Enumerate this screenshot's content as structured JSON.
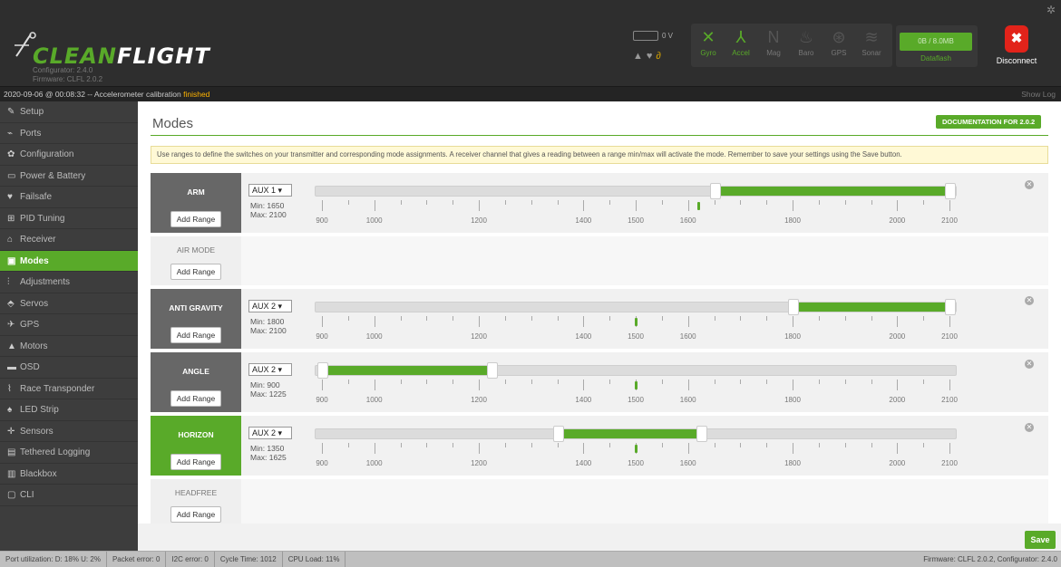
{
  "header": {
    "brand": "CLEANFLIGHT",
    "configurator": "Configurator: 2.4.0",
    "firmware": "Firmware: CLFL 2.0.2",
    "battery_voltage": "0 V",
    "sensors": [
      {
        "label": "Gyro",
        "icon": "gyro-icon",
        "active": true
      },
      {
        "label": "Accel",
        "icon": "accel-icon",
        "active": true
      },
      {
        "label": "Mag",
        "icon": "mag-icon",
        "active": false
      },
      {
        "label": "Baro",
        "icon": "baro-icon",
        "active": false
      },
      {
        "label": "GPS",
        "icon": "gps-icon",
        "active": false
      },
      {
        "label": "Sonar",
        "icon": "sonar-icon",
        "active": false
      }
    ],
    "dataflash_usage": "0B / 8.0MB",
    "dataflash_label": "Dataflash",
    "disconnect_label": "Disconnect"
  },
  "log": {
    "text": "2020-09-06 @ 00:08:32 -- Accelerometer calibration ",
    "highlight": "finished",
    "show_log": "Show Log"
  },
  "sidebar": {
    "items": [
      {
        "label": "Setup",
        "icon": "wrench-icon"
      },
      {
        "label": "Ports",
        "icon": "plug-icon"
      },
      {
        "label": "Configuration",
        "icon": "gear-icon"
      },
      {
        "label": "Power & Battery",
        "icon": "battery-icon"
      },
      {
        "label": "Failsafe",
        "icon": "failsafe-icon"
      },
      {
        "label": "PID Tuning",
        "icon": "pid-icon"
      },
      {
        "label": "Receiver",
        "icon": "receiver-icon"
      },
      {
        "label": "Modes",
        "icon": "modes-icon",
        "active": true
      },
      {
        "label": "Adjustments",
        "icon": "sliders-icon"
      },
      {
        "label": "Servos",
        "icon": "servo-icon"
      },
      {
        "label": "GPS",
        "icon": "satellite-icon"
      },
      {
        "label": "Motors",
        "icon": "motor-icon"
      },
      {
        "label": "OSD",
        "icon": "osd-icon"
      },
      {
        "label": "Race Transponder",
        "icon": "transponder-icon"
      },
      {
        "label": "LED Strip",
        "icon": "led-icon"
      },
      {
        "label": "Sensors",
        "icon": "sensor-icon"
      },
      {
        "label": "Tethered Logging",
        "icon": "logging-icon"
      },
      {
        "label": "Blackbox",
        "icon": "blackbox-icon"
      },
      {
        "label": "CLI",
        "icon": "terminal-icon"
      }
    ]
  },
  "main": {
    "title": "Modes",
    "doc_button": "DOCUMENTATION FOR 2.0.2",
    "note": "Use ranges to define the switches on your transmitter and corresponding mode assignments. A receiver channel that gives a reading between a range min/max will activate the mode. Remember to save your settings using the Save button.",
    "add_range": "Add Range",
    "save": "Save",
    "scale_labels": [
      "900",
      "1000",
      "1200",
      "1400",
      "1500",
      "1600",
      "1800",
      "2000",
      "2100"
    ],
    "modes": [
      {
        "name": "ARM",
        "channel": "AUX 1",
        "min": "Min: 1650",
        "max": "Max: 2100",
        "range": [
          1650,
          2100
        ],
        "current": 1620,
        "state": "range"
      },
      {
        "name": "AIR MODE",
        "state": "empty"
      },
      {
        "name": "ANTI GRAVITY",
        "channel": "AUX 2",
        "min": "Min: 1800",
        "max": "Max: 2100",
        "range": [
          1800,
          2100
        ],
        "current": 1500,
        "state": "range"
      },
      {
        "name": "ANGLE",
        "channel": "AUX 2",
        "min": "Min: 900",
        "max": "Max: 1225",
        "range": [
          900,
          1225
        ],
        "current": 1500,
        "state": "range"
      },
      {
        "name": "HORIZON",
        "channel": "AUX 2",
        "min": "Min: 1350",
        "max": "Max: 1625",
        "range": [
          1350,
          1625
        ],
        "current": 1500,
        "state": "active"
      },
      {
        "name": "HEADFREE",
        "state": "empty"
      }
    ]
  },
  "status": {
    "port_util": "Port utilization: D: 18% U: 2%",
    "packet_error": "Packet error: 0",
    "i2c_error": "I2C error: 0",
    "cycle_time": "Cycle Time: 1012",
    "cpu_load": "CPU Load: 11%",
    "right": "Firmware: CLFL 2.0.2, Configurator: 2.4.0"
  }
}
